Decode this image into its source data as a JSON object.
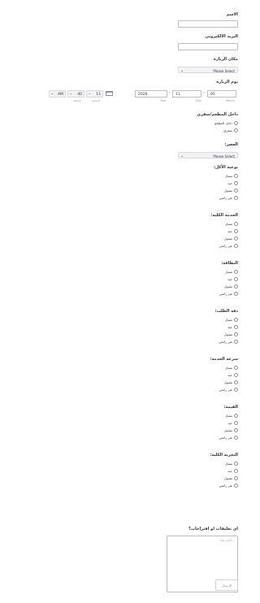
{
  "fields": {
    "name": {
      "label": "الاسم"
    },
    "email": {
      "label": "البريد الالكتروني"
    },
    "visit_place": {
      "label": "مكان الزيارة",
      "selected": "Please Select"
    },
    "visit_day": {
      "label": "يوم الزيارة",
      "month": "05",
      "day": "11",
      "year": "2026",
      "month_label": "Month",
      "day_label": "Day",
      "year_label": "Year",
      "hour": "11",
      "minute": "40",
      "ampm": "AM",
      "hour_label": "الساعة",
      "minute_label": "الدقيقة"
    },
    "dine_type": {
      "label": "داخل المطعم/سفري",
      "options": [
        "داخل المطعم",
        "سفري"
      ]
    },
    "meal_time": {
      "label": "العصر:",
      "selected": "Please Select"
    }
  },
  "ratings": [
    {
      "label": "نوعية الأكل:",
      "options": [
        "ممتاز",
        "جيد",
        "مقبول",
        "غير راضي"
      ]
    },
    {
      "label": "الخدمة الكلية:",
      "options": [
        "ممتاز",
        "جيد",
        "مقبول",
        "غير راضي"
      ]
    },
    {
      "label": "النظافة:",
      "options": [
        "ممتاز",
        "جيد",
        "مقبول",
        "غير راضي"
      ]
    },
    {
      "label": "دقة الطلب:",
      "options": [
        "ممتاز",
        "جيد",
        "مقبول",
        "غير راضي"
      ]
    },
    {
      "label": "سرعة الخدمة:",
      "options": [
        "ممتاز",
        "جيد",
        "مقبول",
        "غير راضي"
      ]
    },
    {
      "label": "القيمة:",
      "options": [
        "ممتاز",
        "جيد",
        "مقبول",
        "غير راضي"
      ]
    },
    {
      "label": "التجربة الكلية:",
      "options": [
        "ممتاز",
        "جيد",
        "مقبول",
        "غير راضي"
      ]
    }
  ],
  "comments": {
    "label": "اي تعليقات او اقتراحات؟",
    "placeholder": "اكتب هنا..."
  },
  "submit": {
    "label": "الإرسال"
  },
  "icons": {
    "chevron": "chevron-down-icon",
    "calendar": "calendar-icon",
    "resize": "resize-grip-icon"
  },
  "colors": {
    "text": "#2c3345",
    "border": "#b8bdc9",
    "select_bg": "#f3f3f5"
  }
}
